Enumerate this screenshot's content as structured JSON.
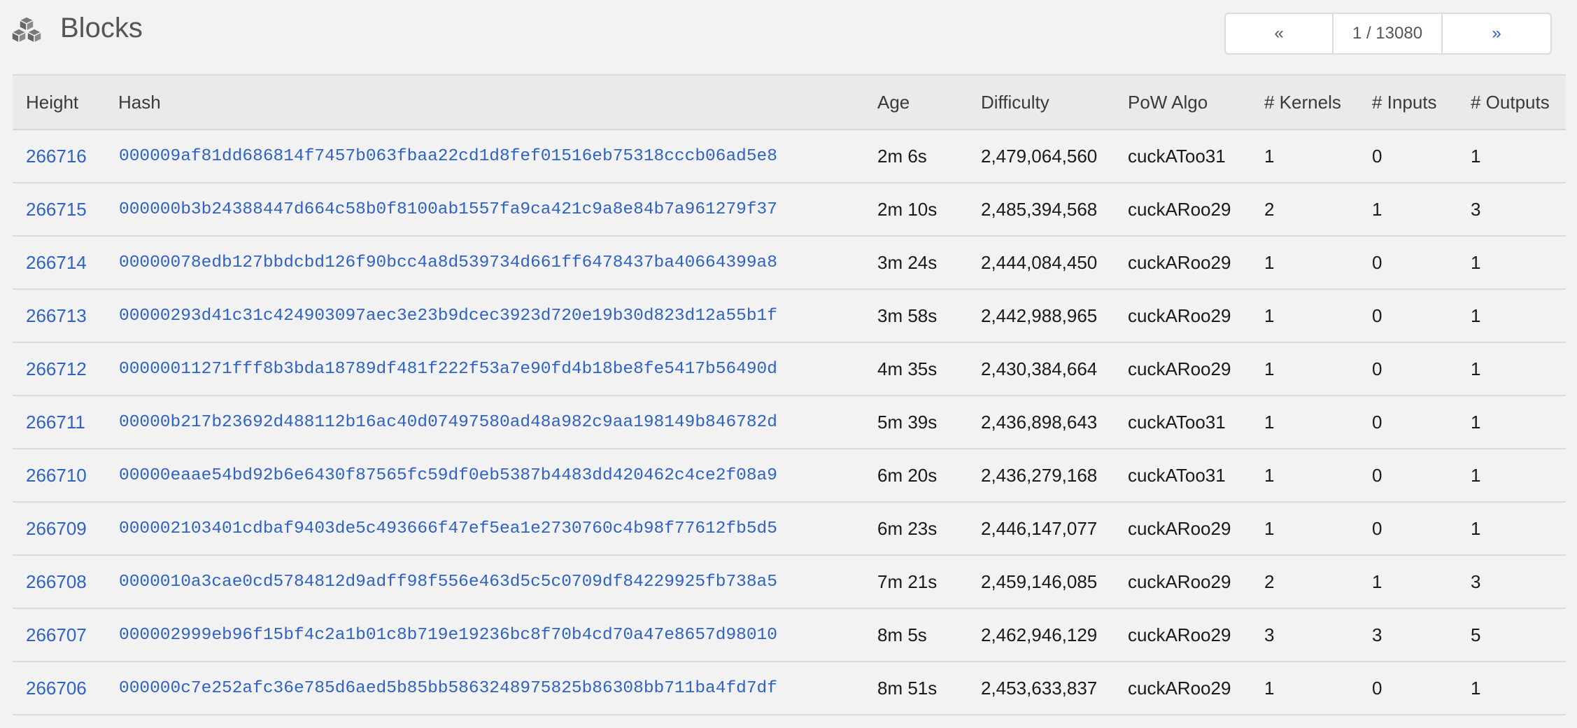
{
  "header": {
    "icon": "cubes-icon",
    "title": "Blocks"
  },
  "pager": {
    "prev_label": "«",
    "page_info": "1 / 13080",
    "next_label": "»"
  },
  "table": {
    "columns": [
      "Height",
      "Hash",
      "Age",
      "Difficulty",
      "PoW Algo",
      "# Kernels",
      "# Inputs",
      "# Outputs"
    ],
    "rows": [
      {
        "height": "266716",
        "hash": "000009af81dd686814f7457b063fbaa22cd1d8fef01516eb75318cccb06ad5e8",
        "age": "2m 6s",
        "difficulty": "2,479,064,560",
        "algo": "cuckAToo31",
        "kernels": "1",
        "inputs": "0",
        "outputs": "1"
      },
      {
        "height": "266715",
        "hash": "000000b3b24388447d664c58b0f8100ab1557fa9ca421c9a8e84b7a961279f37",
        "age": "2m 10s",
        "difficulty": "2,485,394,568",
        "algo": "cuckARoo29",
        "kernels": "2",
        "inputs": "1",
        "outputs": "3"
      },
      {
        "height": "266714",
        "hash": "00000078edb127bbdcbd126f90bcc4a8d539734d661ff6478437ba40664399a8",
        "age": "3m 24s",
        "difficulty": "2,444,084,450",
        "algo": "cuckARoo29",
        "kernels": "1",
        "inputs": "0",
        "outputs": "1"
      },
      {
        "height": "266713",
        "hash": "00000293d41c31c424903097aec3e23b9dcec3923d720e19b30d823d12a55b1f",
        "age": "3m 58s",
        "difficulty": "2,442,988,965",
        "algo": "cuckARoo29",
        "kernels": "1",
        "inputs": "0",
        "outputs": "1"
      },
      {
        "height": "266712",
        "hash": "00000011271fff8b3bda18789df481f222f53a7e90fd4b18be8fe5417b56490d",
        "age": "4m 35s",
        "difficulty": "2,430,384,664",
        "algo": "cuckARoo29",
        "kernels": "1",
        "inputs": "0",
        "outputs": "1"
      },
      {
        "height": "266711",
        "hash": "00000b217b23692d488112b16ac40d07497580ad48a982c9aa198149b846782d",
        "age": "5m 39s",
        "difficulty": "2,436,898,643",
        "algo": "cuckAToo31",
        "kernels": "1",
        "inputs": "0",
        "outputs": "1"
      },
      {
        "height": "266710",
        "hash": "00000eaae54bd92b6e6430f87565fc59df0eb5387b4483dd420462c4ce2f08a9",
        "age": "6m 20s",
        "difficulty": "2,436,279,168",
        "algo": "cuckAToo31",
        "kernels": "1",
        "inputs": "0",
        "outputs": "1"
      },
      {
        "height": "266709",
        "hash": "000002103401cdbaf9403de5c493666f47ef5ea1e2730760c4b98f77612fb5d5",
        "age": "6m 23s",
        "difficulty": "2,446,147,077",
        "algo": "cuckARoo29",
        "kernels": "1",
        "inputs": "0",
        "outputs": "1"
      },
      {
        "height": "266708",
        "hash": "0000010a3cae0cd5784812d9adff98f556e463d5c5c0709df84229925fb738a5",
        "age": "7m 21s",
        "difficulty": "2,459,146,085",
        "algo": "cuckARoo29",
        "kernels": "2",
        "inputs": "1",
        "outputs": "3"
      },
      {
        "height": "266707",
        "hash": "000002999eb96f15bf4c2a1b01c8b719e19236bc8f70b4cd70a47e8657d98010",
        "age": "8m 5s",
        "difficulty": "2,462,946,129",
        "algo": "cuckARoo29",
        "kernels": "3",
        "inputs": "3",
        "outputs": "5"
      },
      {
        "height": "266706",
        "hash": "000000c7e252afc36e785d6aed5b85bb5863248975825b86308bb711ba4fd7df",
        "age": "8m 51s",
        "difficulty": "2,453,633,837",
        "algo": "cuckARoo29",
        "kernels": "1",
        "inputs": "0",
        "outputs": "1"
      }
    ]
  }
}
